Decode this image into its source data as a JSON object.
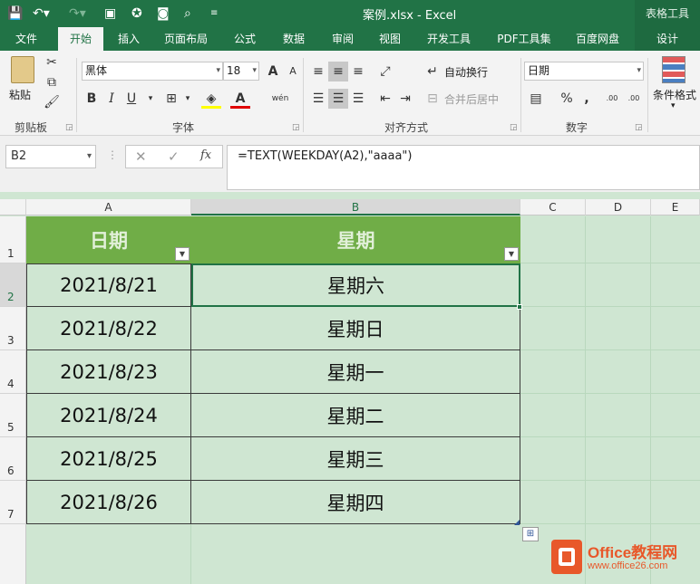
{
  "window": {
    "title": "案例.xlsx - Excel",
    "context_tab_group": "表格工具"
  },
  "tabs": [
    "文件",
    "开始",
    "插入",
    "页面布局",
    "公式",
    "数据",
    "审阅",
    "视图",
    "开发工具",
    "PDF工具集",
    "百度网盘",
    "设计"
  ],
  "ribbon": {
    "clipboard": {
      "paste": "粘贴",
      "group": "剪贴板"
    },
    "font": {
      "name": "黑体",
      "size": "18",
      "group": "字体",
      "bold": "B",
      "italic": "I",
      "underline": "U",
      "grow": "A",
      "shrink": "A",
      "color_letter": "A",
      "phonetic": "wén"
    },
    "alignment": {
      "wrap": "自动换行",
      "merge": "合并后居中",
      "group": "对齐方式"
    },
    "number": {
      "format": "日期",
      "group": "数字",
      "percent": "%",
      "comma": ",",
      "inc_decimal": ".00",
      "dec_decimal": ".00"
    },
    "styles": {
      "conditional": "条件格式"
    }
  },
  "formula_bar": {
    "name_box": "B2",
    "cancel": "✕",
    "enter": "✓",
    "fx": "fx",
    "formula": "=TEXT(WEEKDAY(A2),\"aaaa\")"
  },
  "columns": [
    "A",
    "B",
    "C",
    "D",
    "E"
  ],
  "rows": [
    "1",
    "2",
    "3",
    "4",
    "5",
    "6",
    "7"
  ],
  "table": {
    "headers": [
      "日期",
      "星期"
    ],
    "data": [
      [
        "2021/8/21",
        "星期六"
      ],
      [
        "2021/8/22",
        "星期日"
      ],
      [
        "2021/8/23",
        "星期一"
      ],
      [
        "2021/8/24",
        "星期二"
      ],
      [
        "2021/8/25",
        "星期三"
      ],
      [
        "2021/8/26",
        "星期四"
      ]
    ]
  },
  "watermark": {
    "text1": "Office教程网",
    "text2": "www.office26.com"
  },
  "colors": {
    "excel_green": "#217346",
    "header_fill": "#70ad47",
    "table_fill": "#cfe6d2"
  }
}
